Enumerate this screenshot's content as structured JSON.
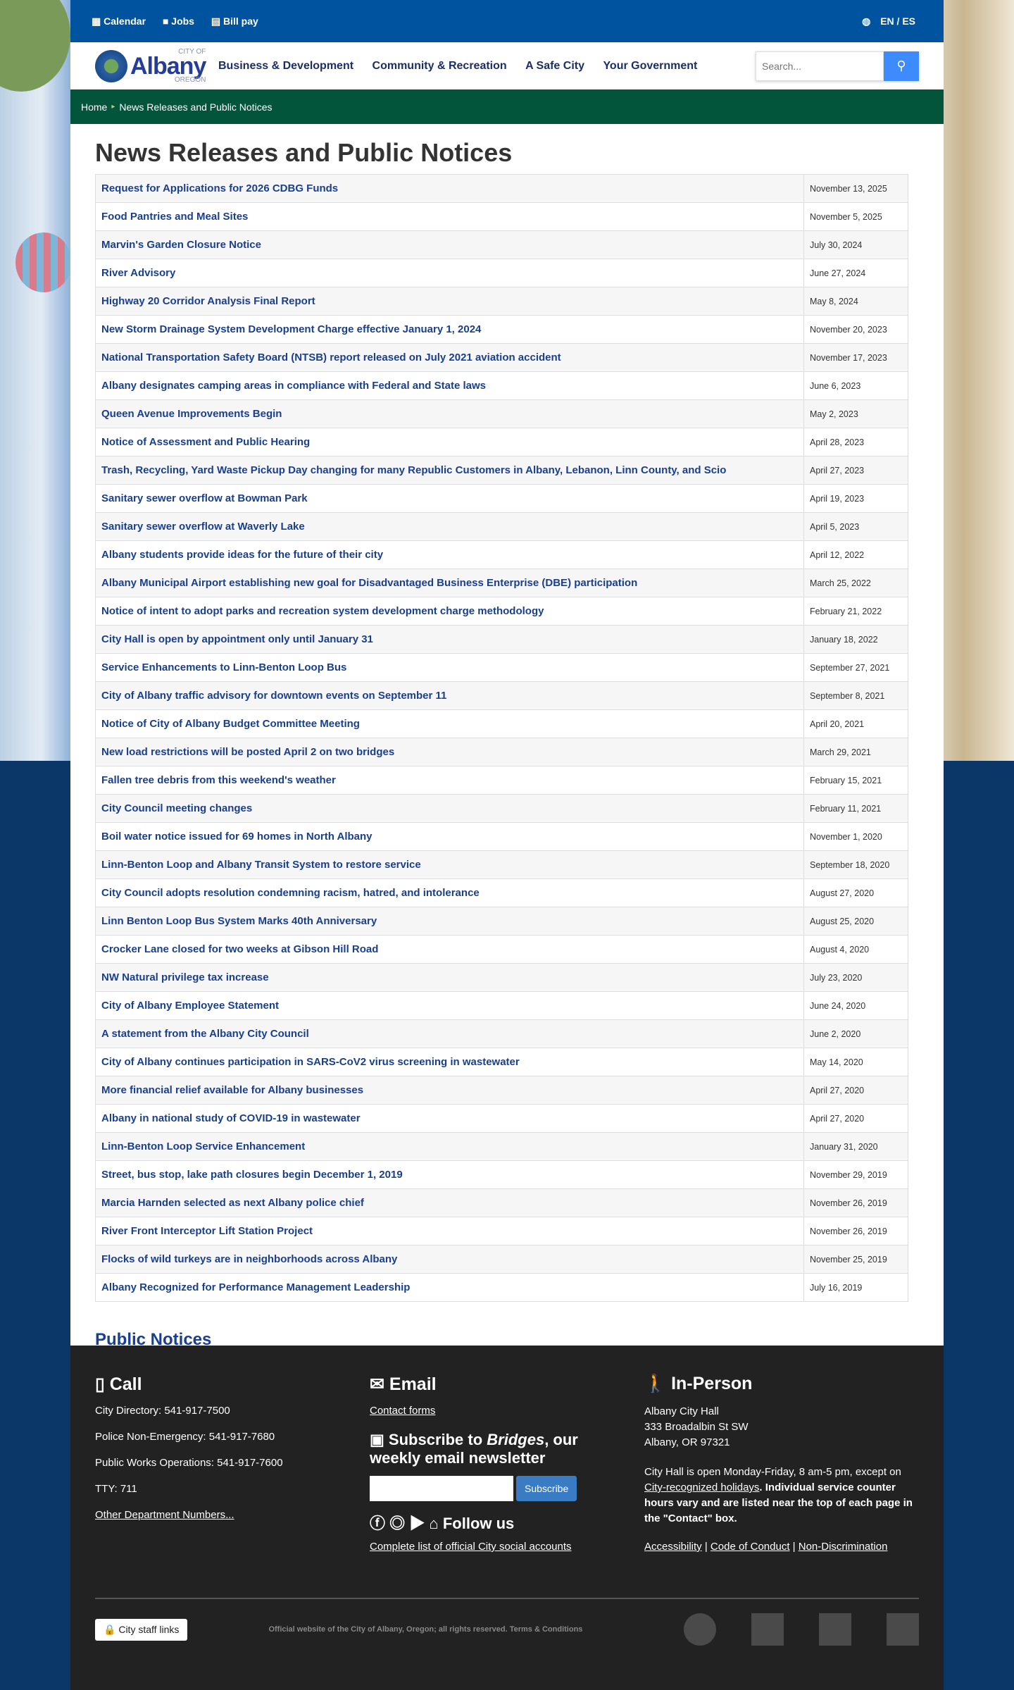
{
  "topbar": {
    "links": [
      "Calendar",
      "Jobs",
      "Bill pay"
    ],
    "lang": "EN / ES"
  },
  "nav": {
    "logo_small": "CITY OF",
    "logo": "Albany",
    "logo_sub": "OREGON",
    "items": [
      "Business & Development",
      "Community & Recreation",
      "A Safe City",
      "Your Government"
    ],
    "search_placeholder": "Search..."
  },
  "breadcrumb": {
    "home": "Home",
    "current": "News Releases and Public Notices"
  },
  "page_title": "News Releases and Public Notices",
  "news": [
    [
      "Request for Applications for 2026 CDBG Funds",
      "November 13, 2025"
    ],
    [
      "Food Pantries and Meal Sites",
      "November 5, 2025"
    ],
    [
      "Marvin's Garden Closure Notice",
      "July 30, 2024"
    ],
    [
      "River Advisory",
      "June 27, 2024"
    ],
    [
      "Highway 20 Corridor Analysis Final Report",
      "May 8, 2024"
    ],
    [
      "New Storm Drainage System Development Charge effective January 1, 2024",
      "November 20, 2023"
    ],
    [
      "National Transportation Safety Board (NTSB) report released on July 2021 aviation accident",
      "November 17, 2023"
    ],
    [
      "Albany designates camping areas in compliance with Federal and State laws",
      "June 6, 2023"
    ],
    [
      "Queen Avenue Improvements Begin",
      "May 2, 2023"
    ],
    [
      "Notice of Assessment and Public Hearing",
      "April 28, 2023"
    ],
    [
      "Trash, Recycling, Yard Waste Pickup Day changing for many Republic Customers in Albany, Lebanon, Linn County, and Scio",
      "April 27, 2023"
    ],
    [
      "Sanitary sewer overflow at Bowman Park",
      "April 19, 2023"
    ],
    [
      "Sanitary sewer overflow at Waverly Lake",
      "April 5, 2023"
    ],
    [
      "Albany students provide ideas for the future of their city",
      "April 12, 2022"
    ],
    [
      "Albany Municipal Airport establishing new goal for Disadvantaged Business Enterprise (DBE) participation",
      "March 25, 2022"
    ],
    [
      "Notice of intent to adopt parks and recreation system development charge methodology",
      "February 21, 2022"
    ],
    [
      "City Hall is open by appointment only until January 31",
      "January 18, 2022"
    ],
    [
      "Service Enhancements to Linn-Benton Loop Bus",
      "September 27, 2021"
    ],
    [
      "City of Albany traffic advisory for downtown events on September 11",
      "September 8, 2021"
    ],
    [
      "Notice of City of Albany Budget Committee Meeting",
      "April 20, 2021"
    ],
    [
      "New load restrictions will be posted April 2 on two bridges",
      "March 29, 2021"
    ],
    [
      "Fallen tree debris from this weekend's weather",
      "February 15, 2021"
    ],
    [
      "City Council meeting changes",
      "February 11, 2021"
    ],
    [
      "Boil water notice issued for 69 homes in North Albany",
      "November 1, 2020"
    ],
    [
      "Linn-Benton Loop and Albany Transit System to restore service",
      "September 18, 2020"
    ],
    [
      "City Council adopts resolution condemning racism, hatred, and intolerance",
      "August 27, 2020"
    ],
    [
      "Linn Benton Loop Bus System Marks 40th Anniversary",
      "August 25, 2020"
    ],
    [
      "Crocker Lane closed for two weeks at Gibson Hill Road",
      "August 4, 2020"
    ],
    [
      "NW Natural privilege tax increase",
      "July 23, 2020"
    ],
    [
      "City of Albany Employee Statement",
      "June 24, 2020"
    ],
    [
      "A statement from the Albany City Council",
      "June 2, 2020"
    ],
    [
      "City of Albany continues participation in SARS-CoV2 virus screening in wastewater",
      "May 14, 2020"
    ],
    [
      "More financial relief available for Albany businesses",
      "April 27, 2020"
    ],
    [
      "Albany in national study of COVID-19 in wastewater",
      "April 27, 2020"
    ],
    [
      "Linn-Benton Loop Service Enhancement",
      "January 31, 2020"
    ],
    [
      "Street, bus stop, lake path closures begin December 1, 2019",
      "November 29, 2019"
    ],
    [
      "Marcia Harnden selected as next Albany police chief",
      "November 26, 2019"
    ],
    [
      "River Front Interceptor Lift Station Project",
      "November 26, 2019"
    ],
    [
      "Flocks of wild turkeys are in neighborhoods across Albany",
      "November 25, 2019"
    ],
    [
      "Albany Recognized for Performance Management Leadership",
      "July 16, 2019"
    ]
  ],
  "public_notices": "Public Notices",
  "footer": {
    "call": {
      "title": "Call",
      "lines": [
        "City Directory: 541-917-7500",
        "Police Non-Emergency: 541-917-7680",
        "Public Works Operations: 541-917-7600",
        "TTY: 711"
      ],
      "link": "Other Department Numbers..."
    },
    "email": {
      "title": "Email",
      "link": "Contact forms",
      "subscribe_pre": "Subscribe to ",
      "subscribe_em": "Bridges",
      "subscribe_post": ", our weekly email newsletter",
      "button": "Subscribe",
      "follow": "Follow us",
      "social_link": "Complete list of official City social accounts"
    },
    "inperson": {
      "title": "In-Person",
      "address": [
        "Albany City Hall",
        "333 Broadalbin St SW",
        "Albany, OR 97321"
      ],
      "hours_pre": "City Hall is open Monday-Friday, 8 am-5 pm, except on ",
      "holidays": "City-recognized holidays",
      "hours_bold": ". Individual service counter hours vary and are listed near the top of each page in the \"Contact\" box.",
      "links": [
        "Accessibility",
        "Code of Conduct",
        "Non-Discrimination"
      ]
    },
    "staff": "City staff links",
    "legal": "Official website of the City of Albany, Oregon; all rights reserved. Terms & Conditions"
  }
}
